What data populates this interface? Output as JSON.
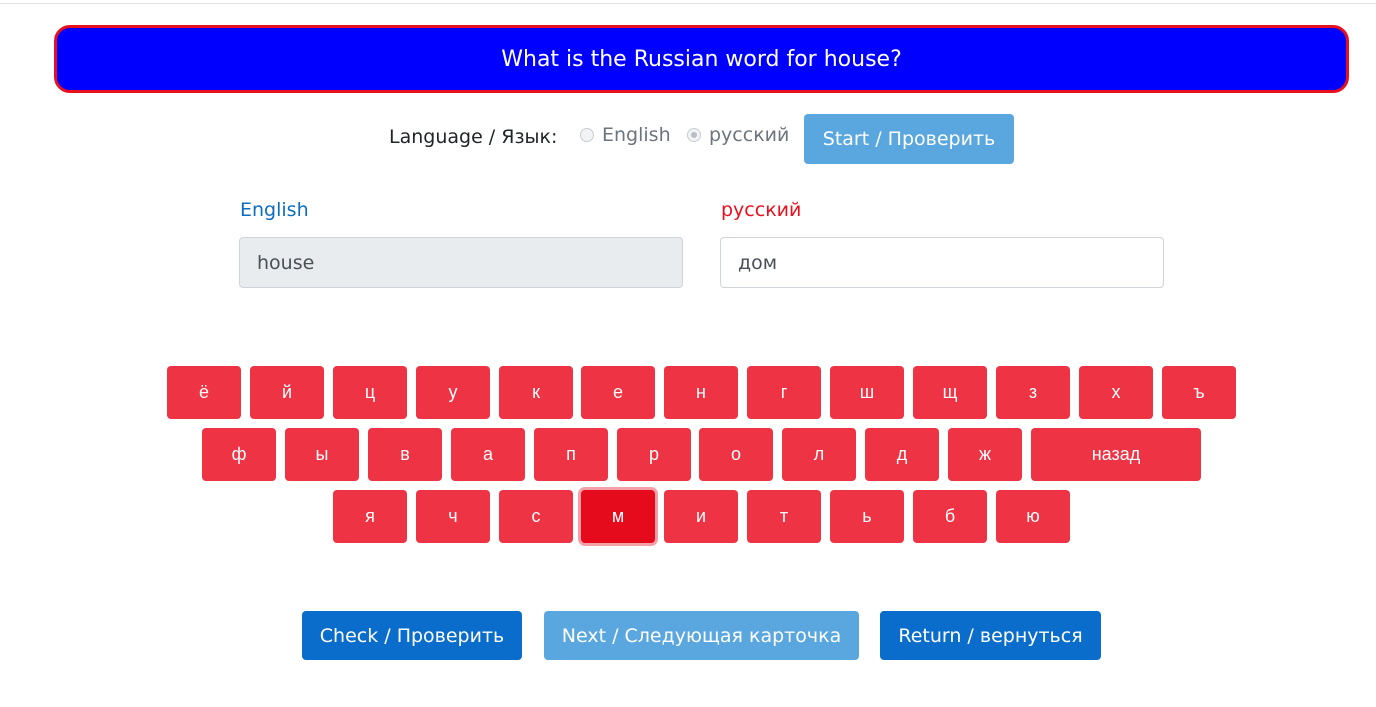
{
  "banner": {
    "question": "What is the Russian word for house?"
  },
  "language": {
    "label": "Language / Язык:",
    "options": [
      {
        "label": "English",
        "checked": false
      },
      {
        "label": "русский",
        "checked": true
      }
    ],
    "start_label": "Start / Проверить"
  },
  "fields": {
    "english_label": "English",
    "english_value": "house",
    "russian_label": "русский",
    "russian_value": "дом"
  },
  "keyboard": {
    "row1": [
      "ё",
      "й",
      "ц",
      "у",
      "к",
      "е",
      "н",
      "г",
      "ш",
      "щ",
      "з",
      "х",
      "ъ"
    ],
    "row2": [
      "ф",
      "ы",
      "в",
      "а",
      "п",
      "р",
      "о",
      "л",
      "д",
      "ж",
      "назад"
    ],
    "row3": [
      "я",
      "ч",
      "с",
      "м",
      "и",
      "т",
      "ь",
      "б",
      "ю"
    ],
    "active_key": "м"
  },
  "actions": {
    "check_label": "Check / Проверить",
    "next_label": "Next / Следующая карточка",
    "return_label": "Return / вернуться"
  },
  "colors": {
    "banner_bg": "#0000ff",
    "banner_border": "#e8101f",
    "key_bg": "#ee3344",
    "primary": "#0a6dcc",
    "primary_light": "#5aa7e0"
  }
}
